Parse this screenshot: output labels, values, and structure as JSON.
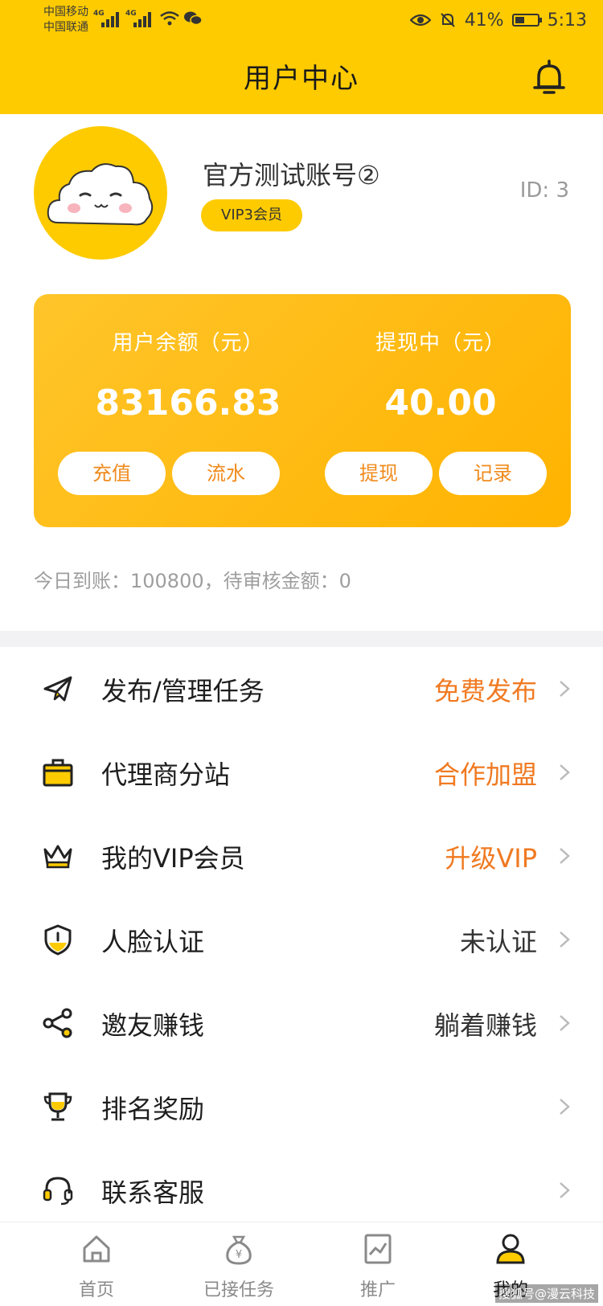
{
  "status_bar": {
    "carrier1": "中国移动",
    "carrier2": "中国联通",
    "net1": "4G",
    "net2": "4G",
    "battery": "41%",
    "time": "5:13"
  },
  "header": {
    "title": "用户中心",
    "bg_color": "#FDCB00"
  },
  "profile": {
    "username": "官方测试账号②",
    "vip": "VIP3会员",
    "id_text": "ID: 3"
  },
  "wallet": {
    "balance_label": "用户余额（元）",
    "balance": "83166.83",
    "withdrawing_label": "提现中（元）",
    "withdrawing": "40.00",
    "buttons": {
      "recharge": "充值",
      "flow": "流水",
      "withdraw": "提现",
      "records": "记录"
    }
  },
  "today_info": "今日到账：100800，待审核金额：0",
  "menu": [
    {
      "label": "发布/管理任务",
      "right": "免费发布",
      "icon": "paper-plane-icon"
    },
    {
      "label": "代理商分站",
      "right": "合作加盟",
      "icon": "briefcase-icon"
    },
    {
      "label": "我的VIP会员",
      "right": "升级VIP",
      "icon": "crown-icon"
    },
    {
      "label": "人脸认证",
      "right": "未认证",
      "icon": "shield-icon"
    },
    {
      "label": "邀友赚钱",
      "right": "躺着赚钱",
      "icon": "share-icon"
    },
    {
      "label": "排名奖励",
      "right": "",
      "icon": "trophy-icon"
    },
    {
      "label": "联系客服",
      "right": "",
      "icon": "headset-icon"
    }
  ],
  "accent_color": "#F07A22",
  "bottom_nav": [
    {
      "label": "首页",
      "icon": "home-icon"
    },
    {
      "label": "已接任务",
      "icon": "money-bag-icon"
    },
    {
      "label": "推广",
      "icon": "chart-icon"
    },
    {
      "label": "我的",
      "icon": "user-icon",
      "active": true
    }
  ],
  "watermark": "搜狐号@漫云科技"
}
